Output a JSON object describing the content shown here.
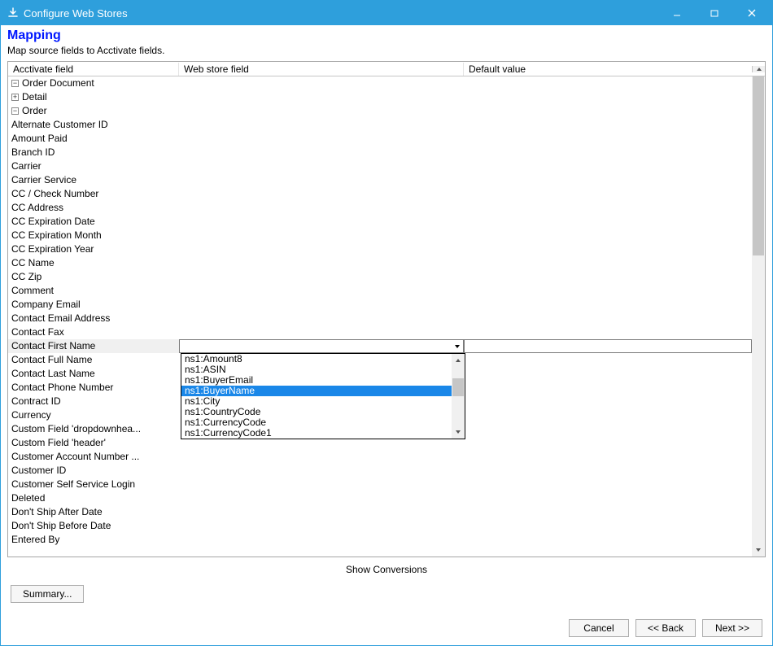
{
  "titlebar": {
    "title": "Configure Web Stores"
  },
  "header": {
    "title": "Mapping",
    "subtitle": "Map source fields to Acctivate fields."
  },
  "columns": {
    "c1": "Acctivate field",
    "c2": "Web store field",
    "c3": "Default value"
  },
  "tree": {
    "root": "Order Document",
    "detail": "Detail",
    "order": "Order",
    "fields": [
      "Alternate Customer ID",
      "Amount Paid",
      "Branch ID",
      "Carrier",
      "Carrier Service",
      "CC / Check Number",
      "CC Address",
      "CC Expiration Date",
      "CC Expiration Month",
      "CC Expiration Year",
      "CC Name",
      "CC Zip",
      "Comment",
      "Company Email",
      "Contact Email Address",
      "Contact Fax",
      "Contact First Name",
      "Contact Full Name",
      "Contact Last Name",
      "Contact Phone Number",
      "Contract ID",
      "Currency",
      "Custom Field 'dropdownhea...",
      "Custom Field 'header'",
      "Customer Account Number ...",
      "Customer ID",
      "Customer Self Service Login",
      "Deleted",
      "Don't Ship After Date",
      "Don't Ship Before Date",
      "Entered By"
    ]
  },
  "selectedIndex": 16,
  "dropdown": {
    "options": [
      "ns1:Amount8",
      "ns1:ASIN",
      "ns1:BuyerEmail",
      "ns1:BuyerName",
      "ns1:City",
      "ns1:CountryCode",
      "ns1:CurrencyCode",
      "ns1:CurrencyCode1"
    ],
    "selectedIndex": 3
  },
  "links": {
    "showConversions": "Show Conversions"
  },
  "buttons": {
    "summary": "Summary...",
    "cancel": "Cancel",
    "back": "<< Back",
    "next": "Next >>"
  }
}
